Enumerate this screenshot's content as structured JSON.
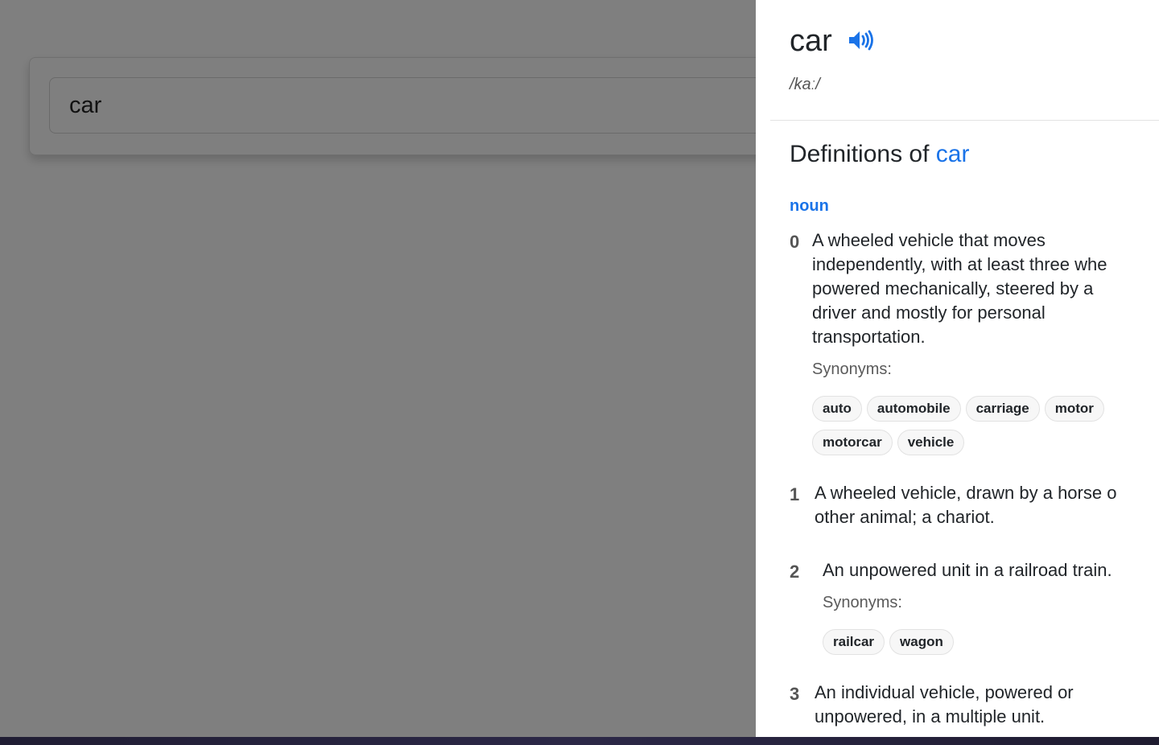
{
  "search": {
    "value": "car"
  },
  "entry": {
    "word": "car",
    "phonetic": "/kaː/",
    "definitions_heading_prefix": "Definitions of ",
    "definitions_heading_word": "car",
    "part_of_speech": "noun",
    "synonyms_label": "Synonyms:",
    "senses": [
      {
        "number": "0",
        "lines": [
          "A wheeled vehicle that moves",
          "independently, with at least three whe",
          "powered mechanically, steered by a",
          "driver and mostly for personal",
          "transportation."
        ],
        "synonyms_rows": [
          [
            "auto",
            "automobile",
            "carriage",
            "motor"
          ],
          [
            "motorcar",
            "vehicle"
          ]
        ]
      },
      {
        "number": "1",
        "lines": [
          "A wheeled vehicle, drawn by a horse o",
          "other animal; a chariot."
        ],
        "synonyms_rows": []
      },
      {
        "number": "2",
        "lines": [
          "An unpowered unit in a railroad train."
        ],
        "synonyms_rows": [
          [
            "railcar",
            "wagon"
          ]
        ]
      },
      {
        "number": "3",
        "lines": [
          "An individual vehicle, powered or",
          "unpowered, in a multiple unit."
        ],
        "synonyms_rows": []
      }
    ]
  },
  "icons": {
    "speaker": "speaker-volume-icon"
  },
  "colors": {
    "accent": "#1a73e8",
    "overlay": "rgba(0,0,0,0.5)"
  }
}
